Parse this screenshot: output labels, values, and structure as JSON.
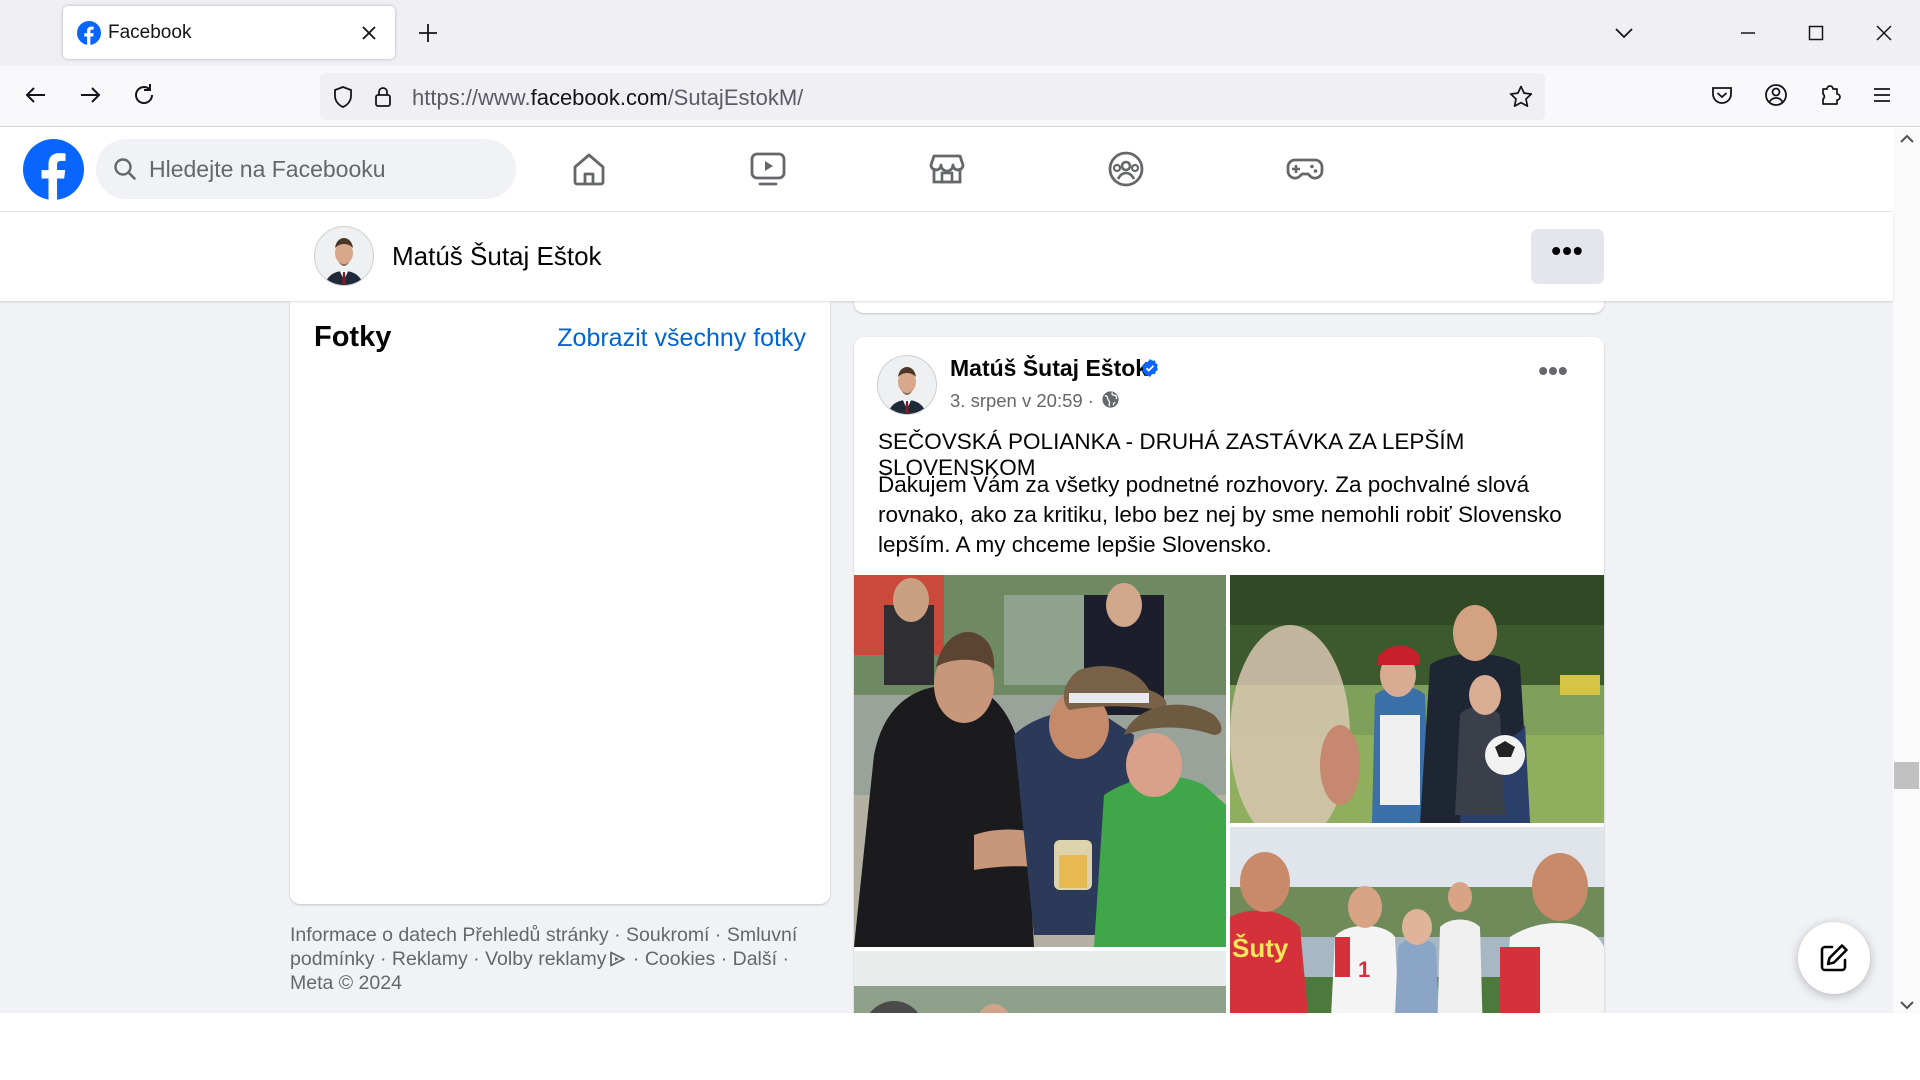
{
  "browser": {
    "tab_title": "Facebook",
    "url_prefix": "https://www.",
    "url_domain": "facebook.com",
    "url_path": "/SutajEstokM/",
    "icons": [
      "facebook-favicon",
      "close-icon",
      "plus-icon",
      "chevron-down-icon",
      "minimize-icon",
      "maximize-icon",
      "close-window-icon",
      "back-icon",
      "forward-icon",
      "reload-icon",
      "shield-icon",
      "lock-icon",
      "star-icon",
      "pocket-icon",
      "account-icon",
      "extensions-icon",
      "menu-icon"
    ]
  },
  "fb": {
    "search_placeholder": "Hledejte na Facebooku",
    "nav_icons": [
      "home-icon",
      "video-icon",
      "marketplace-icon",
      "groups-icon",
      "gaming-icon"
    ]
  },
  "page_header": {
    "name": "Matúš Šutaj Eštok",
    "more": "•••"
  },
  "photos": {
    "title": "Fotky",
    "see_all": "Zobrazit všechny fotky"
  },
  "footer": {
    "links": [
      "Informace o datech Přehledů stránky",
      "Soukromí",
      "Smluvní podmínky",
      "Reklamy",
      "Volby reklamy",
      "Cookies",
      "Další"
    ],
    "copyright": "Meta © 2024",
    "sep": " · "
  },
  "post": {
    "author": "Matúš Šutaj Eštok",
    "date": "3. srpen v 20:59 ·",
    "more": "•••",
    "headline": "SEČOVSKÁ POLIANKA - DRUHÁ ZASTÁVKA ZA LEPŠÍM SLOVENSKOM",
    "body": "Ďakujem Vám za všetky podnetné rozhovory. Za pochvalné slová rovnako, ako za kritiku, lebo bez nej by sme nemohli robiť Slovensko lepším. A my chceme lepšie Slovensko.",
    "shirt_text_1": "Šuty",
    "shirt_text_2": "1"
  },
  "colors": {
    "fb_blue": "#0866ff",
    "link_blue": "#0064d1",
    "bg_gray": "#f0f2f5",
    "verified": "#0866ff"
  }
}
